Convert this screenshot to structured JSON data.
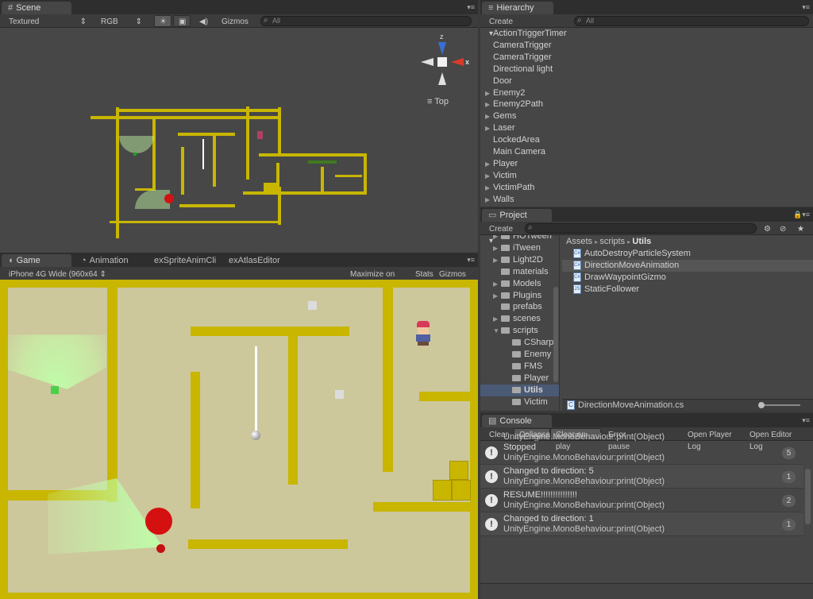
{
  "scene": {
    "tab_label": "Scene",
    "shading_mode": "Textured",
    "render_mode": "RGB",
    "gizmos_label": "Gizmos",
    "search_placeholder": "All",
    "axis_y": "z",
    "axis_x": "x",
    "view_label": "Top"
  },
  "game": {
    "tabs": [
      {
        "label": "Game"
      },
      {
        "label": "Animation"
      },
      {
        "label": "exSpriteAnimCli"
      },
      {
        "label": "exAtlasEditor"
      }
    ],
    "resolution": "iPhone 4G Wide (960x64",
    "maximize_label": "Maximize on Play",
    "stats_label": "Stats",
    "gizmos_label": "Gizmos"
  },
  "hierarchy": {
    "tab_label": "Hierarchy",
    "create_label": "Create",
    "search_placeholder": "All",
    "items": [
      {
        "label": "ActionTriggerTimer",
        "expandable": false
      },
      {
        "label": "CameraTrigger",
        "expandable": false
      },
      {
        "label": "CameraTrigger",
        "expandable": false
      },
      {
        "label": "Directional light",
        "expandable": false
      },
      {
        "label": "Door",
        "expandable": false
      },
      {
        "label": "Enemy2",
        "expandable": true
      },
      {
        "label": "Enemy2Path",
        "expandable": true
      },
      {
        "label": "Gems",
        "expandable": true
      },
      {
        "label": "Laser",
        "expandable": true
      },
      {
        "label": "LockedArea",
        "expandable": false
      },
      {
        "label": "Main Camera",
        "expandable": false
      },
      {
        "label": "Player",
        "expandable": true
      },
      {
        "label": "Victim",
        "expandable": true
      },
      {
        "label": "VictimPath",
        "expandable": true
      },
      {
        "label": "Walls",
        "expandable": true
      }
    ]
  },
  "project": {
    "tab_label": "Project",
    "create_label": "Create",
    "breadcrumb": [
      "Assets",
      "scripts",
      "Utils"
    ],
    "folders": [
      {
        "label": "HOTween",
        "indent": 1,
        "arrow": "▶"
      },
      {
        "label": "iTween",
        "indent": 1,
        "arrow": "▶"
      },
      {
        "label": "Light2D",
        "indent": 1,
        "arrow": "▶"
      },
      {
        "label": "materials",
        "indent": 1,
        "arrow": ""
      },
      {
        "label": "Models",
        "indent": 1,
        "arrow": "▶"
      },
      {
        "label": "Plugins",
        "indent": 1,
        "arrow": "▶"
      },
      {
        "label": "prefabs",
        "indent": 1,
        "arrow": ""
      },
      {
        "label": "scenes",
        "indent": 1,
        "arrow": "▶"
      },
      {
        "label": "scripts",
        "indent": 1,
        "arrow": "▼"
      },
      {
        "label": "CSharp",
        "indent": 2,
        "arrow": ""
      },
      {
        "label": "Enemy",
        "indent": 2,
        "arrow": ""
      },
      {
        "label": "FMS",
        "indent": 2,
        "arrow": ""
      },
      {
        "label": "Player",
        "indent": 2,
        "arrow": ""
      },
      {
        "label": "Utils",
        "indent": 2,
        "arrow": "",
        "selected": true
      },
      {
        "label": "Victim",
        "indent": 2,
        "arrow": ""
      }
    ],
    "files": [
      {
        "label": "AutoDestroyParticleSystem",
        "type": "C#"
      },
      {
        "label": "DirectionMoveAnimation",
        "type": "C#",
        "selected": true
      },
      {
        "label": "DrawWaypointGizmo",
        "type": "C#"
      },
      {
        "label": "StaticFollower",
        "type": "JS"
      }
    ],
    "selected_file": "DirectionMoveAnimation.cs"
  },
  "console": {
    "tab_label": "Console",
    "buttons": {
      "clear": "Clear",
      "collapse": "Collapse",
      "clear_on_play": "Clear on play",
      "error_pause": "Error pause",
      "open_player_log": "Open Player Log",
      "open_editor_log": "Open Editor Log"
    },
    "partial_line": "UnityEngine.MonoBehaviour:print(Object)",
    "entries": [
      {
        "message": "Stopped",
        "source": "UnityEngine.MonoBehaviour:print(Object)",
        "count": "5"
      },
      {
        "message": "Changed to direction: 5",
        "source": "UnityEngine.MonoBehaviour:print(Object)",
        "count": "1"
      },
      {
        "message": "RESUME!!!!!!!!!!!!!!!",
        "source": "UnityEngine.MonoBehaviour:print(Object)",
        "count": "2"
      },
      {
        "message": "Changed to direction: 1",
        "source": "UnityEngine.MonoBehaviour:print(Object)",
        "count": "1"
      }
    ]
  }
}
